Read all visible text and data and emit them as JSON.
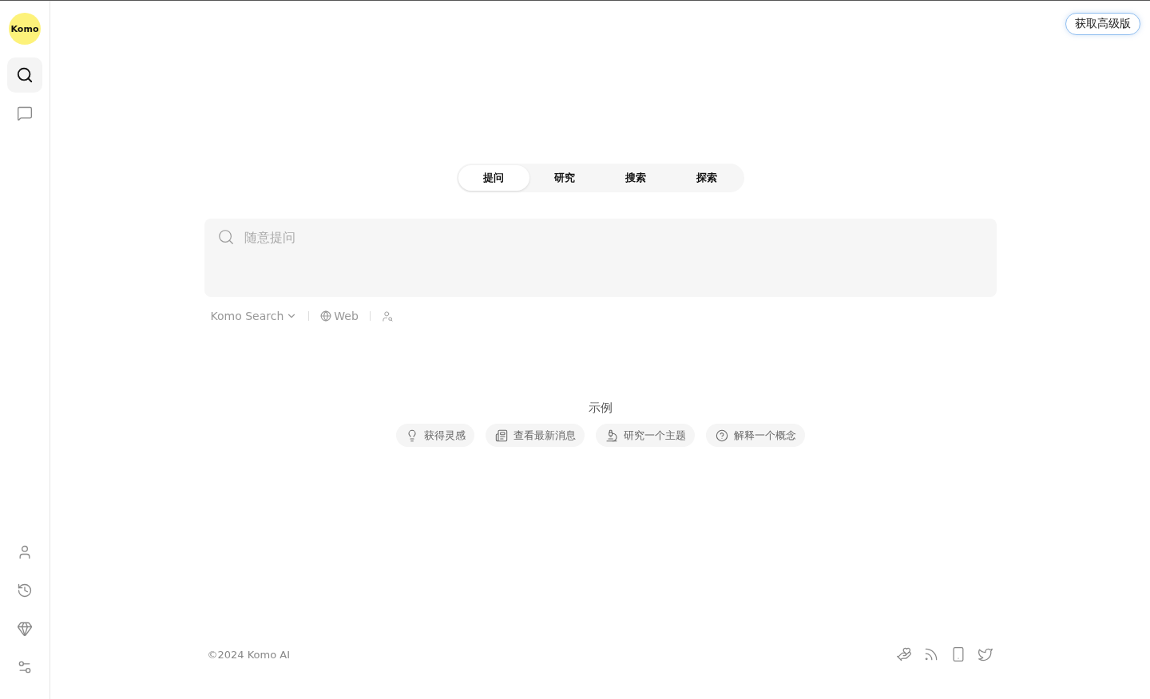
{
  "sidebar": {
    "logo": "Komo",
    "top_items": [
      {
        "kind": "search",
        "selected": true
      },
      {
        "kind": "chat",
        "selected": false
      }
    ],
    "bottom_items": [
      {
        "kind": "user",
        "selected": false
      },
      {
        "kind": "history",
        "selected": false
      },
      {
        "kind": "gem",
        "selected": false
      },
      {
        "kind": "settings",
        "selected": false
      }
    ]
  },
  "upgrade_button": "获取高级版",
  "tabs": [
    {
      "label": "提问",
      "selected": true
    },
    {
      "label": "研究",
      "selected": false
    },
    {
      "label": "搜索",
      "selected": false
    },
    {
      "label": "探索",
      "selected": false
    }
  ],
  "search": {
    "placeholder": "随意提问"
  },
  "options": {
    "model": "Komo Search",
    "source": "Web"
  },
  "examples": {
    "title": "示例",
    "items": [
      {
        "kind": "idea",
        "label": "获得灵感"
      },
      {
        "kind": "news",
        "label": "查看最新消息"
      },
      {
        "kind": "research",
        "label": "研究一个主题"
      },
      {
        "kind": "explain",
        "label": "解释一个概念"
      }
    ]
  },
  "footer": {
    "copyright": "©2024 Komo AI",
    "links": [
      {
        "kind": "donate"
      },
      {
        "kind": "rss"
      },
      {
        "kind": "phone"
      },
      {
        "kind": "twitter"
      }
    ]
  }
}
